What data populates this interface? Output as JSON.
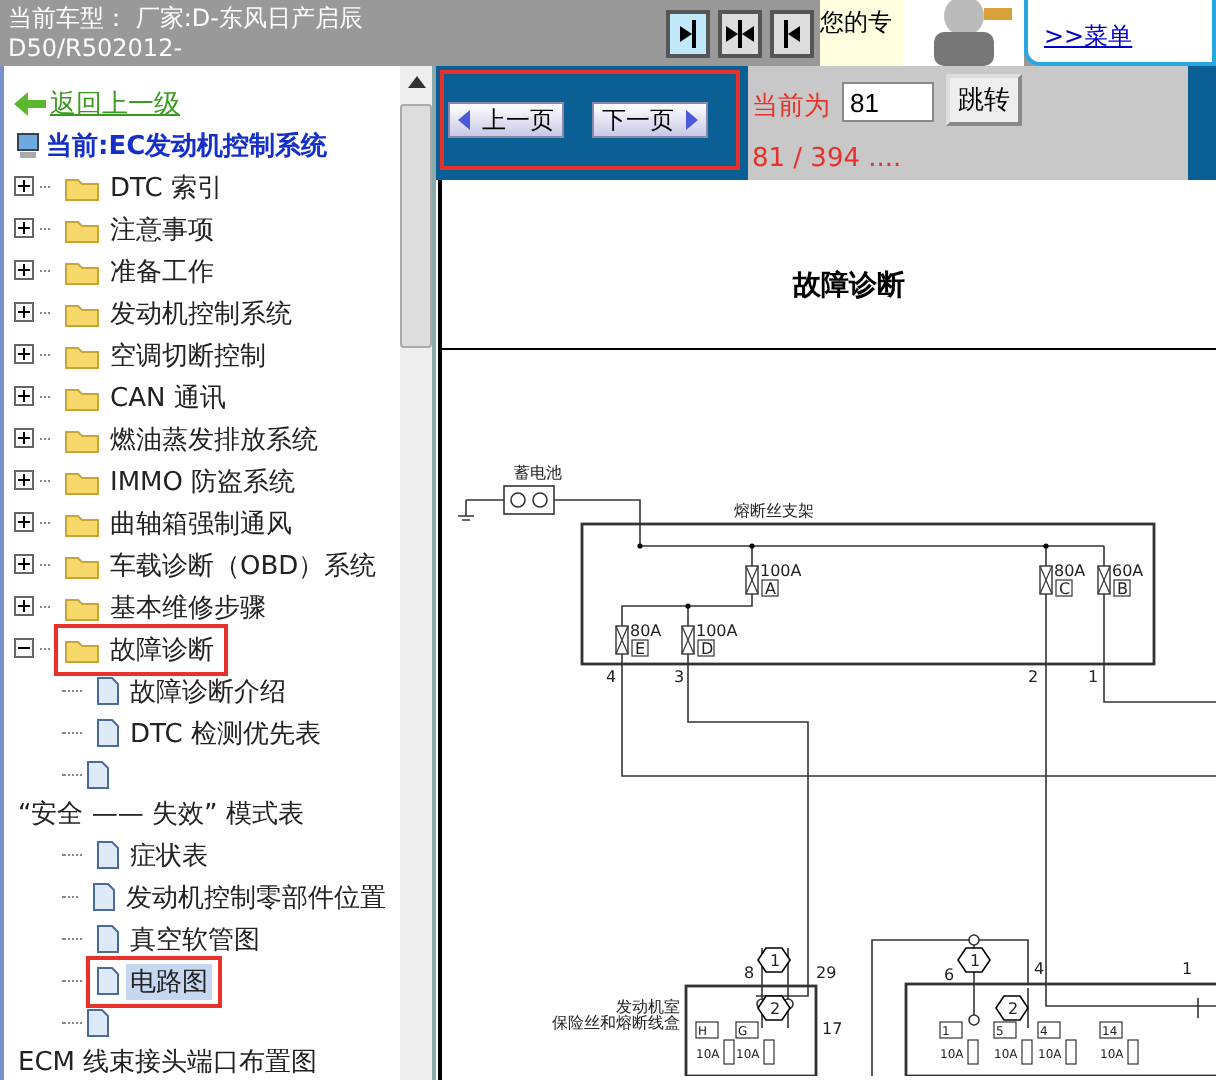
{
  "header": {
    "car_model": [
      "当前车型： 厂家:D-东风日产启辰",
      "D50/R502012-"
    ],
    "view_buttons": [
      {
        "kind": "right",
        "selected": true
      },
      {
        "kind": "both",
        "selected": false
      },
      {
        "kind": "left",
        "selected": false
      }
    ],
    "notice": "您的专",
    "hint_link": ">>菜单"
  },
  "tree": {
    "back_link": "返回上一级",
    "current": "当前:EC发动机控制系统",
    "items": [
      {
        "label": "DTC 索引",
        "expanded": false,
        "annotated": false,
        "selected": false
      },
      {
        "label": "注意事项",
        "expanded": false,
        "annotated": false,
        "selected": false
      },
      {
        "label": "准备工作",
        "expanded": false,
        "annotated": false,
        "selected": false
      },
      {
        "label": "发动机控制系统",
        "expanded": false,
        "annotated": false,
        "selected": false
      },
      {
        "label": "空调切断控制",
        "expanded": false,
        "annotated": false,
        "selected": false
      },
      {
        "label": "CAN 通讯",
        "expanded": false,
        "annotated": false,
        "selected": false
      },
      {
        "label": "燃油蒸发排放系统",
        "expanded": false,
        "annotated": false,
        "selected": false
      },
      {
        "label": "IMMO 防盗系统",
        "expanded": false,
        "annotated": false,
        "selected": false
      },
      {
        "label": "曲轴箱强制通风",
        "expanded": false,
        "annotated": false,
        "selected": false
      },
      {
        "label": "车载诊断（OBD）系统",
        "expanded": false,
        "annotated": false,
        "selected": false
      },
      {
        "label": "基本维修步骤",
        "expanded": false,
        "annotated": false,
        "selected": false
      },
      {
        "label": "故障诊断",
        "expanded": true,
        "annotated": true,
        "selected": false,
        "children": [
          {
            "label": "故障诊断介绍",
            "kind": "inline",
            "annotated": false,
            "selected": false
          },
          {
            "label": "DTC 检测优先表",
            "kind": "inline",
            "annotated": false,
            "selected": false
          },
          {
            "label": "“安全 —— 失效” 模式表",
            "kind": "wrapped",
            "annotated": false,
            "selected": false
          },
          {
            "label": "症状表",
            "kind": "inline",
            "annotated": false,
            "selected": false
          },
          {
            "label": "发动机控制零部件位置",
            "kind": "inline",
            "annotated": false,
            "selected": false
          },
          {
            "label": "真空软管图",
            "kind": "inline",
            "annotated": false,
            "selected": false
          },
          {
            "label": "电路图",
            "kind": "inline",
            "annotated": true,
            "selected": true
          },
          {
            "label": "ECM 线束接头端口布置图",
            "kind": "wrapped",
            "annotated": false,
            "selected": false
          }
        ]
      }
    ]
  },
  "pager": {
    "annotated": true,
    "prev": "上一页",
    "next": "下一页",
    "current_label": "当前为",
    "page_input": "81",
    "jump": "跳转",
    "page_count": "81 / 394 ...."
  },
  "document": {
    "title": "故障诊断",
    "battery_label": "蓄电池",
    "fusible_link_label": "熔断丝支架",
    "fuses": [
      {
        "rating": "100A",
        "letter": "A"
      },
      {
        "rating": "80A",
        "letter": "C"
      },
      {
        "rating": "60A",
        "letter": "B"
      },
      {
        "rating": "80A",
        "letter": "E"
      },
      {
        "rating": "100A",
        "letter": "D"
      }
    ],
    "pins": [
      "4",
      "3",
      "2",
      "1"
    ],
    "engine_box_label": [
      "发动机室",
      "保险丝和熔断线盒"
    ],
    "terminal_numbers": [
      "8",
      "29",
      "17",
      "6",
      "4",
      "1"
    ],
    "connectors": [
      "1",
      "2",
      "1",
      "2"
    ],
    "small_fuses": [
      {
        "rating": "10A",
        "letter": "H"
      },
      {
        "rating": "10A",
        "letter": "G"
      },
      {
        "rating": "10A",
        "letter": "1"
      },
      {
        "rating": "10A",
        "letter": "5"
      },
      {
        "rating": "10A",
        "letter": "4"
      },
      {
        "rating": "10A",
        "letter": "14"
      }
    ]
  }
}
